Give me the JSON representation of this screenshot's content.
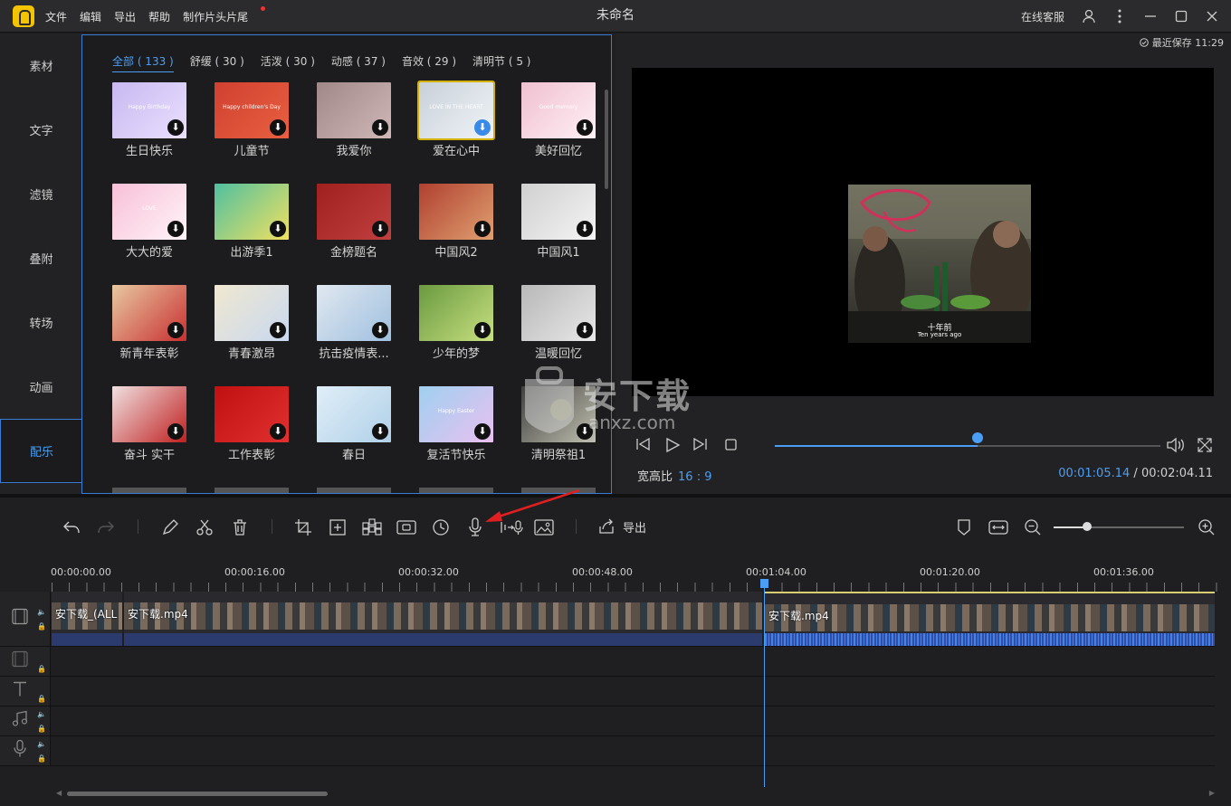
{
  "titlebar": {
    "menus": [
      "文件",
      "编辑",
      "导出",
      "帮助",
      "制作片头片尾"
    ],
    "title": "未命名",
    "service": "在线客服"
  },
  "sidebar": {
    "items": [
      "素材",
      "文字",
      "滤镜",
      "叠附",
      "转场",
      "动画",
      "配乐"
    ],
    "active_index": 6
  },
  "library": {
    "categories": [
      "全部 ( 133 )",
      "舒缓 ( 30 )",
      "活泼 ( 30 )",
      "动感 ( 37 )",
      "音效 ( 29 )",
      "清明节 ( 5 )"
    ],
    "active_category": 0,
    "items": [
      "生日快乐",
      "儿童节",
      "我爱你",
      "爱在心中",
      "美好回忆",
      "大大的爱",
      "出游季1",
      "金榜题名",
      "中国风2",
      "中国风1",
      "新青年表彰",
      "青春激昂",
      "抗击疫情表...",
      "少年的梦",
      "温暖回忆",
      "奋斗 实干",
      "工作表彰",
      "春日",
      "复活节快乐",
      "清明祭祖1"
    ],
    "selected_index": 3,
    "thumb_texts": {
      "t0": "Happy Birthday",
      "t1": "Happy children's Day",
      "t3": "LOVE IN THE HEART",
      "t4": "Good memory",
      "t5": "LOVE",
      "t18": "Happy Easter"
    },
    "download_glyph": "⬇"
  },
  "preview": {
    "last_saved": "最近保存 11:29",
    "caption_cn": "十年前",
    "caption_en": "Ten years ago",
    "aspect_label": "宽高比",
    "aspect_value": "16 : 9",
    "current_time": "00:01:05.14",
    "time_sep": "/",
    "total_time": "00:02:04.11",
    "progress": 0.526
  },
  "toolbar": {
    "export_label": "导出",
    "zoom_level": 0.26
  },
  "timeline": {
    "ruler": [
      "00:00:00.00",
      "00:00:16.00",
      "00:00:32.00",
      "00:00:48.00",
      "00:01:04.00",
      "00:01:20.00",
      "00:01:36.00"
    ],
    "clips": [
      "安下载_(ALL",
      "安下载.mp4",
      "安下载.mp4"
    ]
  },
  "watermark": {
    "text": "安下载",
    "sub": "anxz.com"
  },
  "colors": {
    "accent": "#4a9ff5",
    "selected_outline": "#d4b000",
    "arrow": "#e02020"
  }
}
